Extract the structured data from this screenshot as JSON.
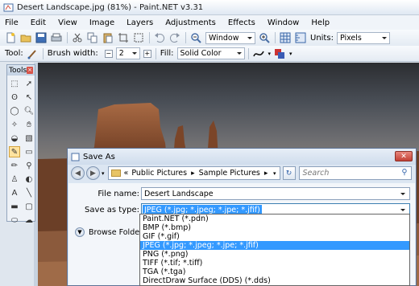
{
  "window": {
    "title": "Desert Landscape.jpg (81%) - Paint.NET v3.31"
  },
  "menu": [
    "File",
    "Edit",
    "View",
    "Image",
    "Layers",
    "Adjustments",
    "Effects",
    "Window",
    "Help"
  ],
  "toolbar1": {
    "window_label": "Window",
    "units_label": "Units:",
    "units_value": "Pixels"
  },
  "toolbar2": {
    "tool_label": "Tool:",
    "brush_label": "Brush width:",
    "brush_value": "2",
    "fill_label": "Fill:",
    "fill_value": "Solid Color"
  },
  "tools_panel": {
    "title": "Tools"
  },
  "dialog": {
    "title": "Save As",
    "path": [
      "Public Pictures",
      "Sample Pictures"
    ],
    "path_prefix": "«",
    "search_placeholder": "Search",
    "filename_label": "File name:",
    "filename_value": "Desert Landscape",
    "savetype_label": "Save as type:",
    "savetype_value": "JPEG (*.jpg; *.jpeg; *.jpe; *.jfif)",
    "browse_label": "Browse Folders"
  },
  "filetypes": [
    "Paint.NET (*.pdn)",
    "BMP (*.bmp)",
    "GIF (*.gif)",
    "JPEG (*.jpg; *.jpeg; *.jpe; *.jfif)",
    "PNG (*.png)",
    "TIFF (*.tif; *.tiff)",
    "TGA (*.tga)",
    "DirectDraw Surface (DDS) (*.dds)"
  ],
  "filetypes_selected_index": 3
}
